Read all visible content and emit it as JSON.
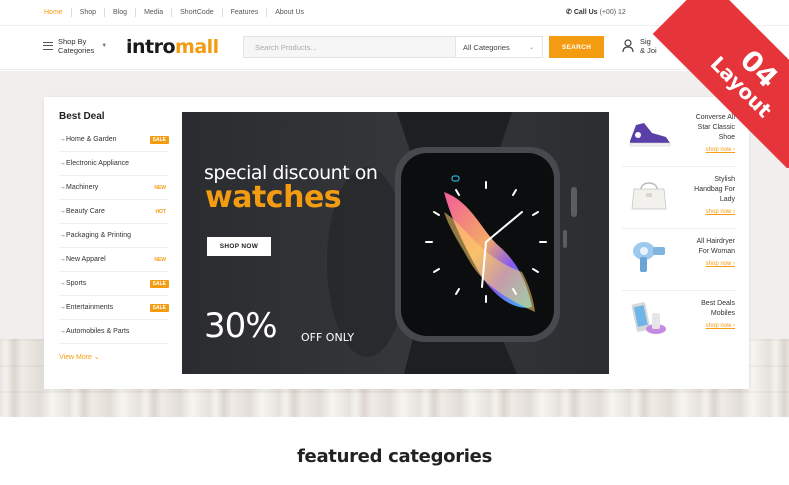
{
  "topnav": {
    "items": [
      "Home",
      "Shop",
      "Blog",
      "Media",
      "ShortCode",
      "Features",
      "About Us"
    ]
  },
  "contact": {
    "label": "Call Us",
    "number": "(+00) 12"
  },
  "header": {
    "categories_line1": "Shop By",
    "categories_line2": "Categories",
    "logo_part1": "intro",
    "logo_part2": "mall",
    "search_placeholder": "Search Products...",
    "category_select": "All Categories",
    "search_button": "SEARCH",
    "account_line1": "Sig",
    "account_line2": "& Joi"
  },
  "deal": {
    "title": "Best Deal",
    "items": [
      {
        "label": "Home & Garden",
        "badge": "SALE"
      },
      {
        "label": "Electronic Appliance",
        "badge": ""
      },
      {
        "label": "Machinery",
        "badge": "NEW"
      },
      {
        "label": "Beauty Care",
        "badge": "HOT"
      },
      {
        "label": "Packaging & Printing",
        "badge": ""
      },
      {
        "label": "New Apparel",
        "badge": "NEW"
      },
      {
        "label": "Sports",
        "badge": "SALE"
      },
      {
        "label": "Entertainments",
        "badge": "SALE"
      },
      {
        "label": "Automobiles & Parts",
        "badge": ""
      }
    ],
    "view_more": "View More"
  },
  "banner": {
    "line1": "special discount on",
    "line2": "watches",
    "button": "SHOP NOW",
    "percent": "30%",
    "off": "OFF ONLY"
  },
  "side_products": [
    {
      "line1": "Converse All",
      "line2": "Star Classic",
      "line3": "Shoe",
      "link": "shop now",
      "icon": "sneaker-image"
    },
    {
      "line1": "Stylish",
      "line2": "Handbag For",
      "line3": "Lady",
      "link": "shop now",
      "icon": "handbag-image"
    },
    {
      "line1": "All Hairdryer",
      "line2": "For Woman",
      "line3": "",
      "link": "shop now",
      "icon": "hairdryer-image"
    },
    {
      "line1": "Best Deals",
      "line2": "Mobiles",
      "line3": "",
      "link": "shop now",
      "icon": "mobile-image"
    }
  ],
  "ribbon": {
    "number": "04",
    "label": "Layout"
  },
  "featured": {
    "title": "featured categories"
  },
  "colors": {
    "accent": "#f39c12",
    "ribbon": "#e5353a",
    "banner_bg": "#2f3134"
  }
}
